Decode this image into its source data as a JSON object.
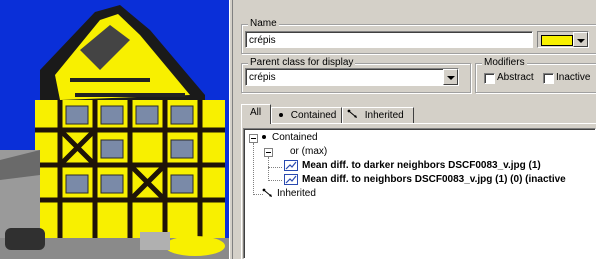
{
  "properties": {
    "name_label": "Name",
    "name_value": "crépis",
    "color_swatch": "#f8f000",
    "parent_class_label": "Parent class for display",
    "parent_class_value": "crépis",
    "modifiers_label": "Modifiers",
    "abstract_label": "Abstract",
    "abstract_checked": false,
    "inactive_label": "Inactive",
    "inactive_checked": false
  },
  "tabs": [
    {
      "label": "All",
      "active": true,
      "icon": "none"
    },
    {
      "label": "Contained",
      "active": false,
      "icon": "dot-icon"
    },
    {
      "label": "Inherited",
      "active": false,
      "icon": "inherit-arrow-icon"
    }
  ],
  "tree": {
    "contained": "Contained",
    "or_max": "or (max)",
    "feature_1": "Mean diff. to darker neighbors DSCF0083_v.jpg (1)",
    "feature_2": "Mean diff. to neighbors DSCF0083_v.jpg (1)  (0) (inactive",
    "inherited": "Inherited"
  },
  "image": {
    "description_icon": "classified-house-image",
    "sky_color": "#0a2fd8",
    "class_color": "#f8f000"
  }
}
